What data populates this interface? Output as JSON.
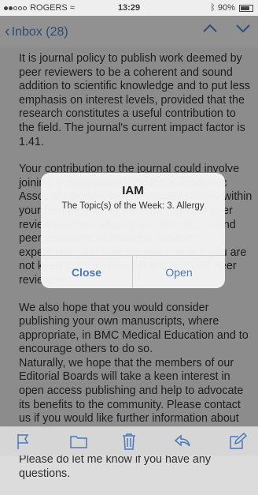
{
  "status_bar": {
    "carrier": "ROGERS",
    "time": "13:29",
    "battery": "90%"
  },
  "nav": {
    "back_label": "Inbox (28)"
  },
  "email": {
    "paragraphs": [
      "It is journal policy to publish work deemed by peer reviewers to be a coherent and sound addition to scientific knowledge and to put less emphasis on interest levels, provided that the research constitutes a useful contribution to the field. The journal's current impact factor is 1.41.",
      "Your contribution to the journal could involve joining an international board of academic Associate Editors to assess manuscripts within your field by guiding them through the peer review process, liaising with our editors and peer reviewers to ensure a positive experience, and take too much time if you are not keen to be involved in this role and peer reviewers.",
      "We also hope that you would consider publishing your own manuscripts, where appropriate, in BMC Medical Education and to encourage others to do so.",
      "Naturally, we hope that the members of our Editorial Boards will take a keen interest in open access publishing and help to advocate its benefits to the community. Please contact us if you would like further information about how to do this or if you have suggestions.",
      "Please do let me know if you have any questions."
    ]
  },
  "alert": {
    "title": "IAM",
    "message": "The Topic(s) of the Week: 3. Allergy",
    "close_label": "Close",
    "open_label": "Open"
  },
  "toolbar": {
    "icons": [
      "flag-icon",
      "folder-icon",
      "trash-icon",
      "reply-icon",
      "compose-icon"
    ]
  },
  "colors": {
    "accent": "#4a78b8",
    "background": "#dcdcdc"
  }
}
